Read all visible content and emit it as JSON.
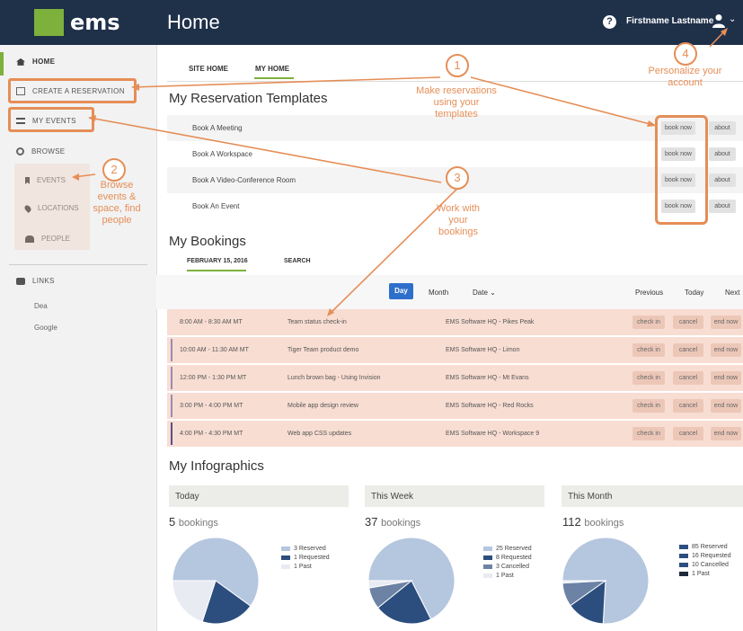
{
  "app": {
    "logo": "ems",
    "page_title": "Home",
    "help": "?",
    "user_name": "Firstname Lastname",
    "caret": "⌄"
  },
  "sidebar": {
    "home": "HOME",
    "create_reservation": "CREATE A RESERVATION",
    "my_events": "MY EVENTS",
    "browse": "BROWSE",
    "events": "EVENTS",
    "locations": "LOCATIONS",
    "people": "PEOPLE",
    "links": "LINKS",
    "link_dea": "Dea",
    "link_google": "Google"
  },
  "tabs": {
    "site_home": "SITE HOME",
    "my_home": "MY HOME"
  },
  "templates": {
    "title": "My Reservation Templates",
    "book_now": "book now",
    "about": "about",
    "rows": [
      "Book A Meeting",
      "Book A Workspace",
      "Book A Video-Conference Room",
      "Book An Event"
    ]
  },
  "bookings": {
    "title": "My Bookings",
    "date_tab": "FEBRUARY 15, 2016",
    "search_tab": "SEARCH",
    "day": "Day",
    "month": "Month",
    "date": "Date ⌄",
    "previous": "Previous",
    "today": "Today",
    "next": "Next",
    "check_in": "check in",
    "cancel": "cancel",
    "end_now": "end now",
    "rows": [
      {
        "time": "8:00 AM - 8:30 AM MT",
        "name": "Team status check-in",
        "location": "EMS Software HQ - Pikes Peak"
      },
      {
        "time": "10:00 AM - 11:30 AM MT",
        "name": "Tiger Team product demo",
        "location": "EMS Software HQ - Limon"
      },
      {
        "time": "12:00 PM - 1:30 PM MT",
        "name": "Lunch brown bag - Using Invision",
        "location": "EMS Software HQ - Mt Evans"
      },
      {
        "time": "3:00 PM - 4:00 PM MT",
        "name": "Mobile app design review",
        "location": "EMS Software HQ - Red Rocks"
      },
      {
        "time": "4:00 PM - 4:30 PM MT",
        "name": "Web app CSS updates",
        "location": "EMS Software HQ - Workspace 9"
      }
    ]
  },
  "infographics": {
    "title": "My Infographics",
    "unit": "bookings",
    "cards": [
      {
        "header": "Today",
        "count": "5",
        "legend": [
          "3 Reserved",
          "1 Requested",
          "1 Past"
        ],
        "values": [
          3,
          1,
          1
        ]
      },
      {
        "header": "This Week",
        "count": "37",
        "legend": [
          "25 Reserved",
          "8 Requested",
          "3 Cancelled",
          "1 Past"
        ],
        "values": [
          25,
          8,
          3,
          1
        ]
      },
      {
        "header": "This Month",
        "count": "112",
        "legend": [
          "85 Reserved",
          "16 Requested",
          "10 Cancelled",
          "1 Past"
        ],
        "values": [
          85,
          16,
          10,
          1
        ]
      }
    ]
  },
  "annotations": {
    "n1": "1",
    "t1": "Make reservations using your templates",
    "n2": "2",
    "t2": "Browse events & space, find people",
    "n3": "3",
    "t3": "Work with your bookings",
    "n4": "4",
    "t4": "Personalize your account"
  },
  "colors": {
    "topbar": "#1f3049",
    "accent": "#7db13b",
    "annotation": "#e58e57",
    "reserved": "#b5c6df",
    "requested": "#2c4e7e",
    "cancelled": "#6d83a5",
    "past": "#e8ebf1"
  }
}
